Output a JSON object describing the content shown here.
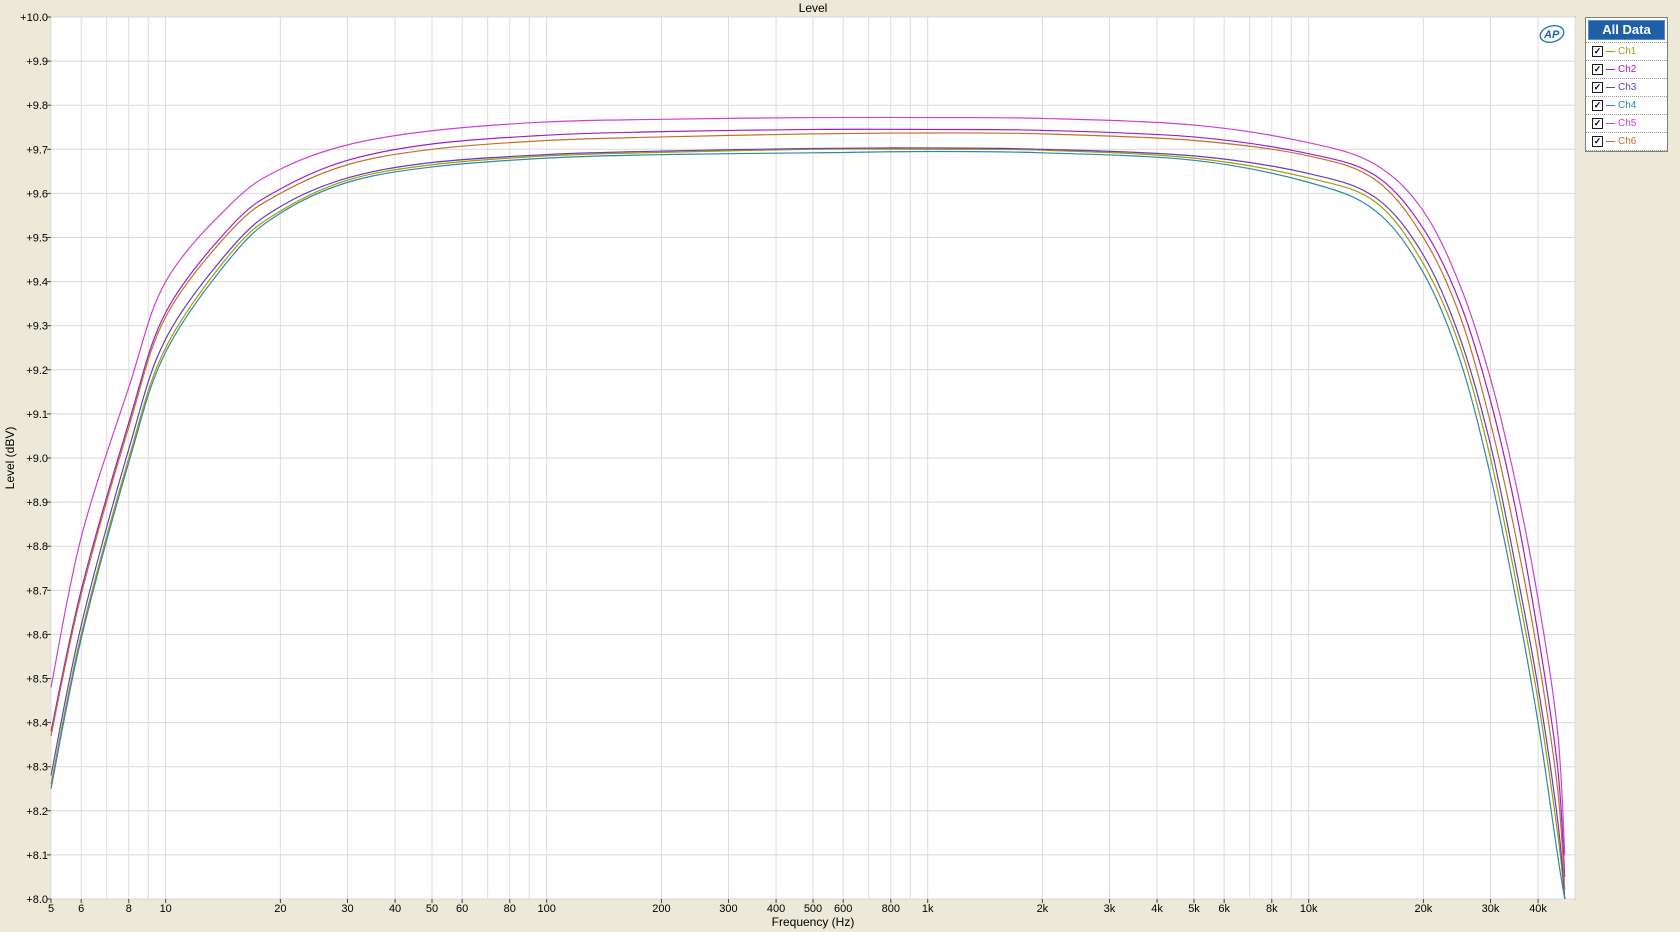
{
  "chart_data": {
    "type": "line",
    "title": "Level",
    "xlabel": "Frequency (Hz)",
    "ylabel": "Level (dBV)",
    "xscale": "log",
    "xlim": [
      5,
      50000
    ],
    "ylim": [
      8.0,
      10.0
    ],
    "grid": true,
    "legend_position": "right",
    "x_ticks": [
      5,
      6,
      8,
      10,
      20,
      30,
      40,
      50,
      60,
      80,
      100,
      200,
      300,
      400,
      500,
      600,
      800,
      1000,
      2000,
      3000,
      4000,
      5000,
      6000,
      8000,
      10000,
      20000,
      30000,
      40000
    ],
    "x_tick_labels": [
      "5",
      "6",
      "8",
      "10",
      "20",
      "30",
      "40",
      "50",
      "60",
      "80",
      "100",
      "200",
      "300",
      "400",
      "500",
      "600",
      "800",
      "1k",
      "2k",
      "3k",
      "4k",
      "5k",
      "6k",
      "8k",
      "10k",
      "20k",
      "30k",
      "40k"
    ],
    "y_ticks": [
      8.0,
      8.1,
      8.2,
      8.3,
      8.4,
      8.5,
      8.6,
      8.7,
      8.8,
      8.9,
      9.0,
      9.1,
      9.2,
      9.3,
      9.4,
      9.5,
      9.6,
      9.7,
      9.8,
      9.9,
      10.0
    ],
    "y_tick_labels": [
      "+8.0",
      "+8.1",
      "+8.2",
      "+8.3",
      "+8.4",
      "+8.5",
      "+8.6",
      "+8.7",
      "+8.8",
      "+8.9",
      "+9.0",
      "+9.1",
      "+9.2",
      "+9.3",
      "+9.4",
      "+9.5",
      "+9.6",
      "+9.7",
      "+9.8",
      "+9.9",
      "+10.0"
    ],
    "x": [
      5,
      6,
      8,
      10,
      15,
      20,
      30,
      50,
      100,
      200,
      500,
      1000,
      2000,
      5000,
      10000,
      15000,
      20000,
      25000,
      30000,
      35000,
      40000,
      45000,
      47000
    ],
    "series": [
      {
        "name": "Ch1",
        "color": "#a89a00",
        "values": [
          8.26,
          8.6,
          9.0,
          9.25,
          9.47,
          9.56,
          9.63,
          9.665,
          9.685,
          9.693,
          9.7,
          9.7,
          9.698,
          9.68,
          9.635,
          9.58,
          9.44,
          9.25,
          9.0,
          8.72,
          8.45,
          8.15,
          8.0
        ]
      },
      {
        "name": "Ch2",
        "color": "#a020c0",
        "values": [
          8.38,
          8.7,
          9.08,
          9.33,
          9.53,
          9.61,
          9.675,
          9.712,
          9.732,
          9.74,
          9.745,
          9.745,
          9.743,
          9.728,
          9.69,
          9.64,
          9.52,
          9.35,
          9.13,
          8.88,
          8.6,
          8.3,
          8.05
        ]
      },
      {
        "name": "Ch3",
        "color": "#6040c0",
        "values": [
          8.28,
          8.62,
          9.02,
          9.27,
          9.48,
          9.57,
          9.635,
          9.67,
          9.688,
          9.696,
          9.702,
          9.703,
          9.7,
          9.685,
          9.645,
          9.59,
          9.46,
          9.27,
          9.03,
          8.75,
          8.48,
          8.18,
          8.0
        ]
      },
      {
        "name": "Ch4",
        "color": "#2a8aa8",
        "values": [
          8.25,
          8.59,
          8.99,
          9.24,
          9.46,
          9.555,
          9.625,
          9.66,
          9.68,
          9.688,
          9.692,
          9.695,
          9.692,
          9.675,
          9.625,
          9.56,
          9.42,
          9.22,
          8.96,
          8.68,
          8.4,
          8.1,
          8.0
        ]
      },
      {
        "name": "Ch5",
        "color": "#d040d0",
        "values": [
          8.48,
          8.82,
          9.16,
          9.4,
          9.58,
          9.655,
          9.71,
          9.742,
          9.762,
          9.768,
          9.772,
          9.772,
          9.77,
          9.755,
          9.715,
          9.665,
          9.56,
          9.39,
          9.18,
          8.94,
          8.68,
          8.38,
          8.1
        ]
      },
      {
        "name": "Ch6",
        "color": "#c07030",
        "values": [
          8.37,
          8.69,
          9.07,
          9.32,
          9.52,
          9.6,
          9.665,
          9.7,
          9.72,
          9.728,
          9.735,
          9.737,
          9.735,
          9.72,
          9.685,
          9.63,
          9.5,
          9.32,
          9.08,
          8.82,
          8.55,
          8.25,
          8.02
        ]
      }
    ]
  },
  "legend": {
    "title": "All Data",
    "check_mark": "✓",
    "items": [
      {
        "label": "Ch1",
        "color": "#a89a00"
      },
      {
        "label": "Ch2",
        "color": "#a020c0"
      },
      {
        "label": "Ch3",
        "color": "#6040c0"
      },
      {
        "label": "Ch4",
        "color": "#2a8aa8"
      },
      {
        "label": "Ch5",
        "color": "#d040d0"
      },
      {
        "label": "Ch6",
        "color": "#c07030"
      }
    ]
  },
  "logo": {
    "text": "AP",
    "icon": "ap-logo-icon"
  }
}
